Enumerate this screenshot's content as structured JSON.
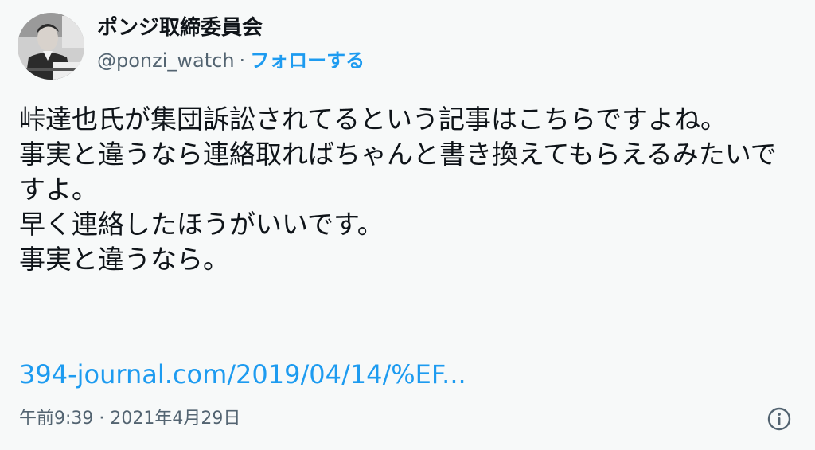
{
  "author": {
    "display_name": "ポンジ取締委員会",
    "handle": "@ponzi_watch",
    "separator": "·",
    "follow_label": "フォローする"
  },
  "tweet": {
    "text": "峠達也氏が集団訴訟されてるという記事はこちらですよね。\n事実と違うなら連絡取ればちゃんと書き換えてもらえるみたいですよ。\n早く連絡したほうがいいです。\n事実と違うなら。",
    "link_text": "394-journal.com/2019/04/14/%EF...",
    "timestamp": "午前9:39 · 2021年4月29日"
  },
  "icons": {
    "info": "info-icon",
    "avatar": "avatar-photo"
  },
  "colors": {
    "accent": "#1d9bf0",
    "secondary_text": "#536471",
    "background": "#f7f9f9"
  }
}
